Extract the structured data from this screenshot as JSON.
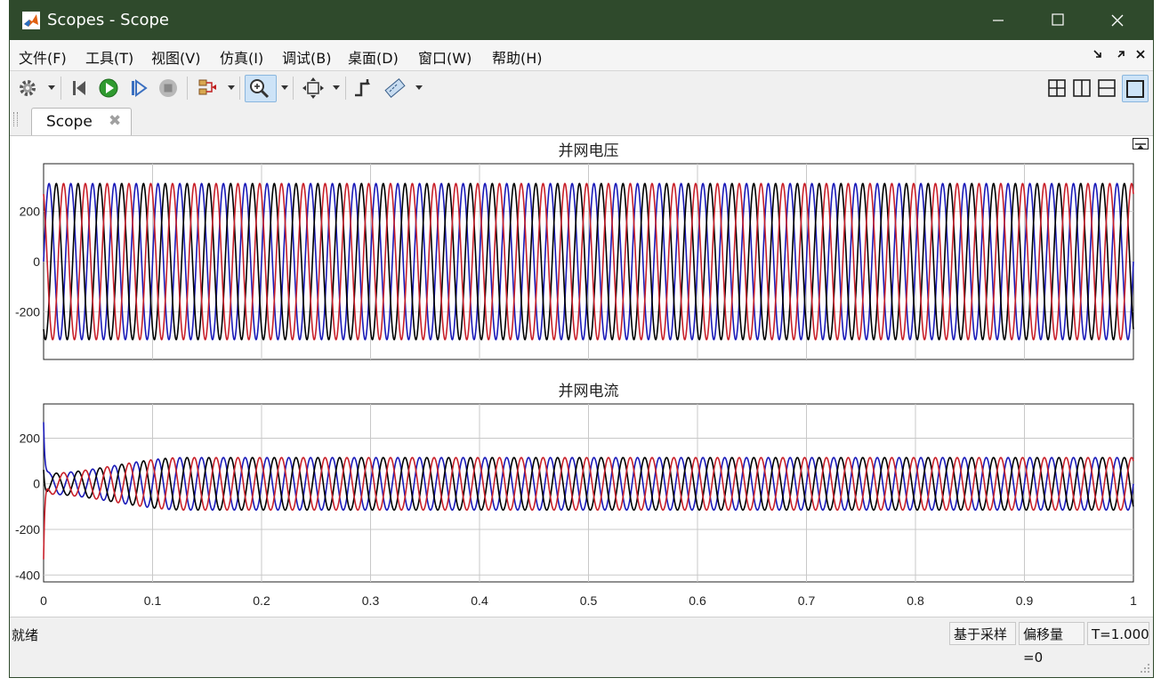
{
  "window": {
    "title": "Scopes - Scope"
  },
  "menu": {
    "items": [
      "文件(F)",
      "工具(T)",
      "视图(V)",
      "仿真(I)",
      "调试(B)",
      "桌面(D)",
      "窗口(W)",
      "帮助(H)"
    ]
  },
  "toolbar": {
    "icons": [
      "settings-icon",
      "step-back-icon",
      "run-icon",
      "step-forward-icon",
      "stop-icon",
      "signal-selector-icon",
      "zoom-in-icon",
      "autoscale-icon",
      "triggers-icon",
      "measurements-icon"
    ],
    "layout_icons": [
      "layout-grid-icon",
      "layout-columns-icon",
      "layout-rows-icon",
      "layout-single-icon"
    ]
  },
  "tab": {
    "label": "Scope",
    "close_glyph": "✖"
  },
  "colors": {
    "phase_a": "#1a1ab8",
    "phase_b": "#c8202a",
    "phase_c": "#000000",
    "titlebar": "#2f4a2c"
  },
  "chart_data": [
    {
      "type": "line",
      "title": "并网电压",
      "xlim": [
        0,
        1
      ],
      "ylim": [
        -390,
        390
      ],
      "yticks": [
        "200",
        "0",
        "-200"
      ],
      "grid": true,
      "frequency_hz": 50,
      "series": [
        {
          "color": "#1a1ab8",
          "amplitude": 311,
          "phase_deg": 0
        },
        {
          "color": "#000000",
          "amplitude": 311,
          "phase_deg": -120
        },
        {
          "color": "#c8202a",
          "amplitude": 311,
          "phase_deg": 120
        }
      ]
    },
    {
      "type": "line",
      "title": "并网电流",
      "xlim": [
        0,
        1
      ],
      "ylim": [
        -430,
        350
      ],
      "yticks": [
        "200",
        "0",
        "-200",
        "-400"
      ],
      "xticks": [
        "0",
        "0.1",
        "0.2",
        "0.3",
        "0.4",
        "0.5",
        "0.6",
        "0.7",
        "0.8",
        "0.9",
        "1"
      ],
      "grid": true,
      "frequency_hz": 50,
      "transient": {
        "peaks": [
          270,
          100,
          -370
        ],
        "initial_amplitude": 45,
        "steady_amplitude": 115,
        "settle_time": 0.13
      },
      "series": [
        {
          "color": "#1a1ab8",
          "phase_deg": 0
        },
        {
          "color": "#000000",
          "phase_deg": -120
        },
        {
          "color": "#c8202a",
          "phase_deg": 120
        }
      ]
    }
  ],
  "status": {
    "text": "就绪",
    "sample_mode": "基于采样",
    "offset": "偏移量=0",
    "time": "T=1.000"
  }
}
